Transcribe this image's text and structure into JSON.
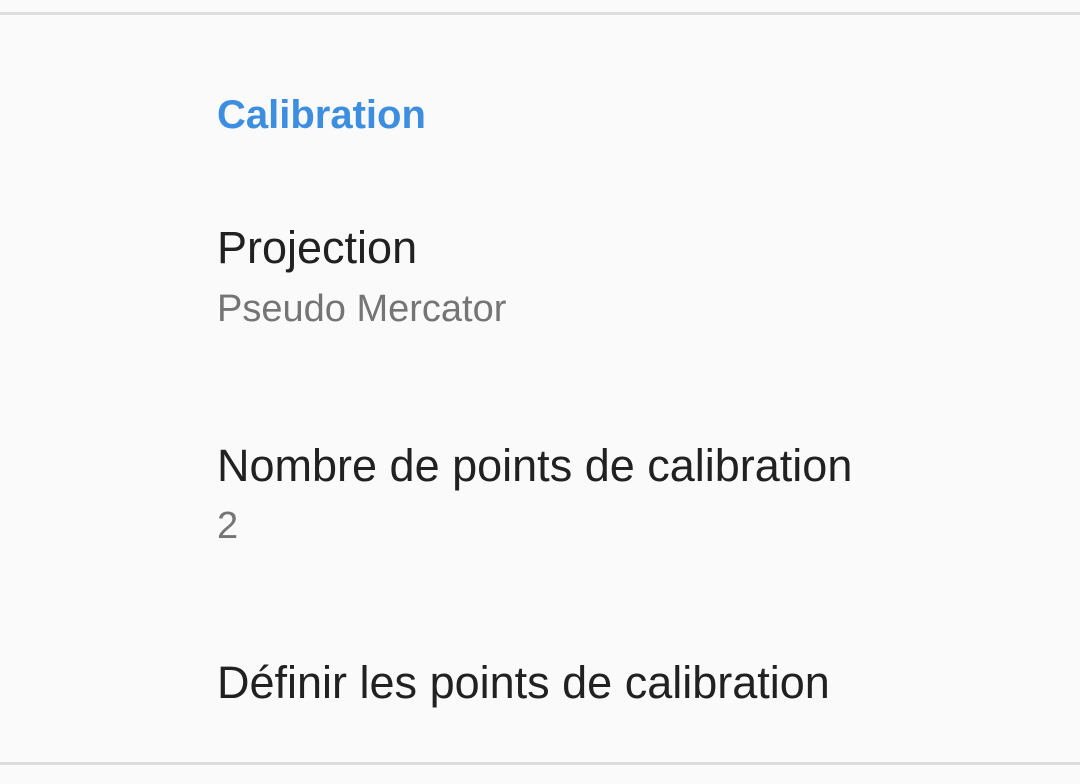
{
  "category": {
    "title": "Calibration",
    "color": "#3d8ee0"
  },
  "preferences": [
    {
      "title": "Projection",
      "summary": "Pseudo Mercator"
    },
    {
      "title": "Nombre de points de calibration",
      "summary": "2"
    },
    {
      "title": "Définir les points de calibration"
    }
  ]
}
